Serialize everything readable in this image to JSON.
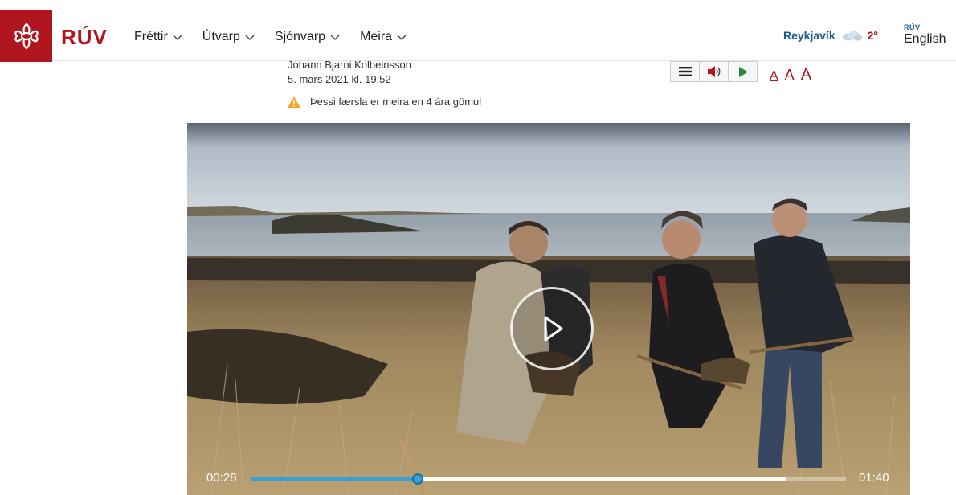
{
  "header": {
    "brand": "RÚV",
    "nav": [
      {
        "label": "Fréttir",
        "active": false
      },
      {
        "label": "Útvarp",
        "active": true
      },
      {
        "label": "Sjónvarp",
        "active": false
      },
      {
        "label": "Meira",
        "active": false
      }
    ],
    "weather": {
      "city": "Reykjavík",
      "temp": "2°",
      "icon": "cloud-icon"
    },
    "lang": {
      "small": "RÚV",
      "big": "English"
    }
  },
  "article": {
    "author": "Jóhann Bjarni Kolbeinsson",
    "date": "5. mars 2021 kl. 19:52",
    "warning": "Þessi færsla er meira en 4 ára gömul",
    "font_sizes": [
      "A",
      "A",
      "A"
    ]
  },
  "video": {
    "current_time": "00:28",
    "duration": "01:40",
    "progress_fraction": 0.28,
    "buffered_fraction": 0.9
  },
  "colors": {
    "brand": "#b1151d",
    "accent_blue": "#1b5b8c",
    "progress": "#3aa0d6"
  }
}
